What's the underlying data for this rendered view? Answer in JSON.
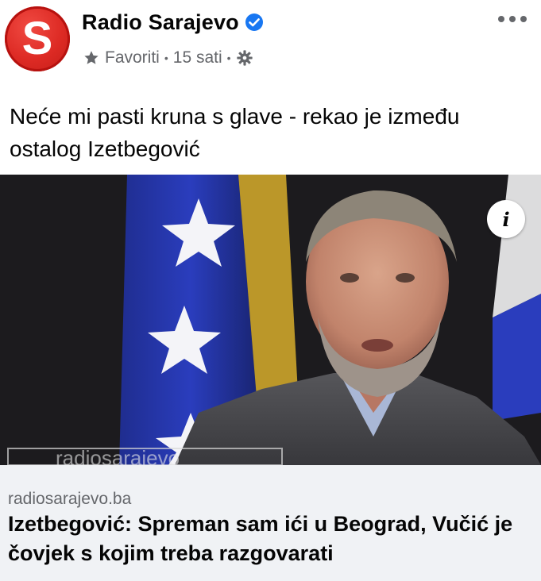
{
  "header": {
    "page_name": "Radio Sarajevo",
    "avatar_letter": "S",
    "meta_favorites": "Favoriti",
    "meta_separator": "•",
    "meta_time": "15 sati",
    "brand_color": "#e0261f",
    "verified_color": "#1877f2",
    "icons": [
      "star-icon",
      "gear-icon",
      "more-options-icon",
      "verified-badge-icon"
    ]
  },
  "post": {
    "caption": "Neće mi pasti kruna s glave - rekao je između ostalog Izetbegović"
  },
  "image": {
    "info_label": "i",
    "watermark": "radiosarajevo"
  },
  "link": {
    "domain": "radiosarajevo.ba",
    "title": "Izetbegović: Spreman sam ići u Beograd, Vučić je čovjek s kojim treba razgovarati"
  }
}
